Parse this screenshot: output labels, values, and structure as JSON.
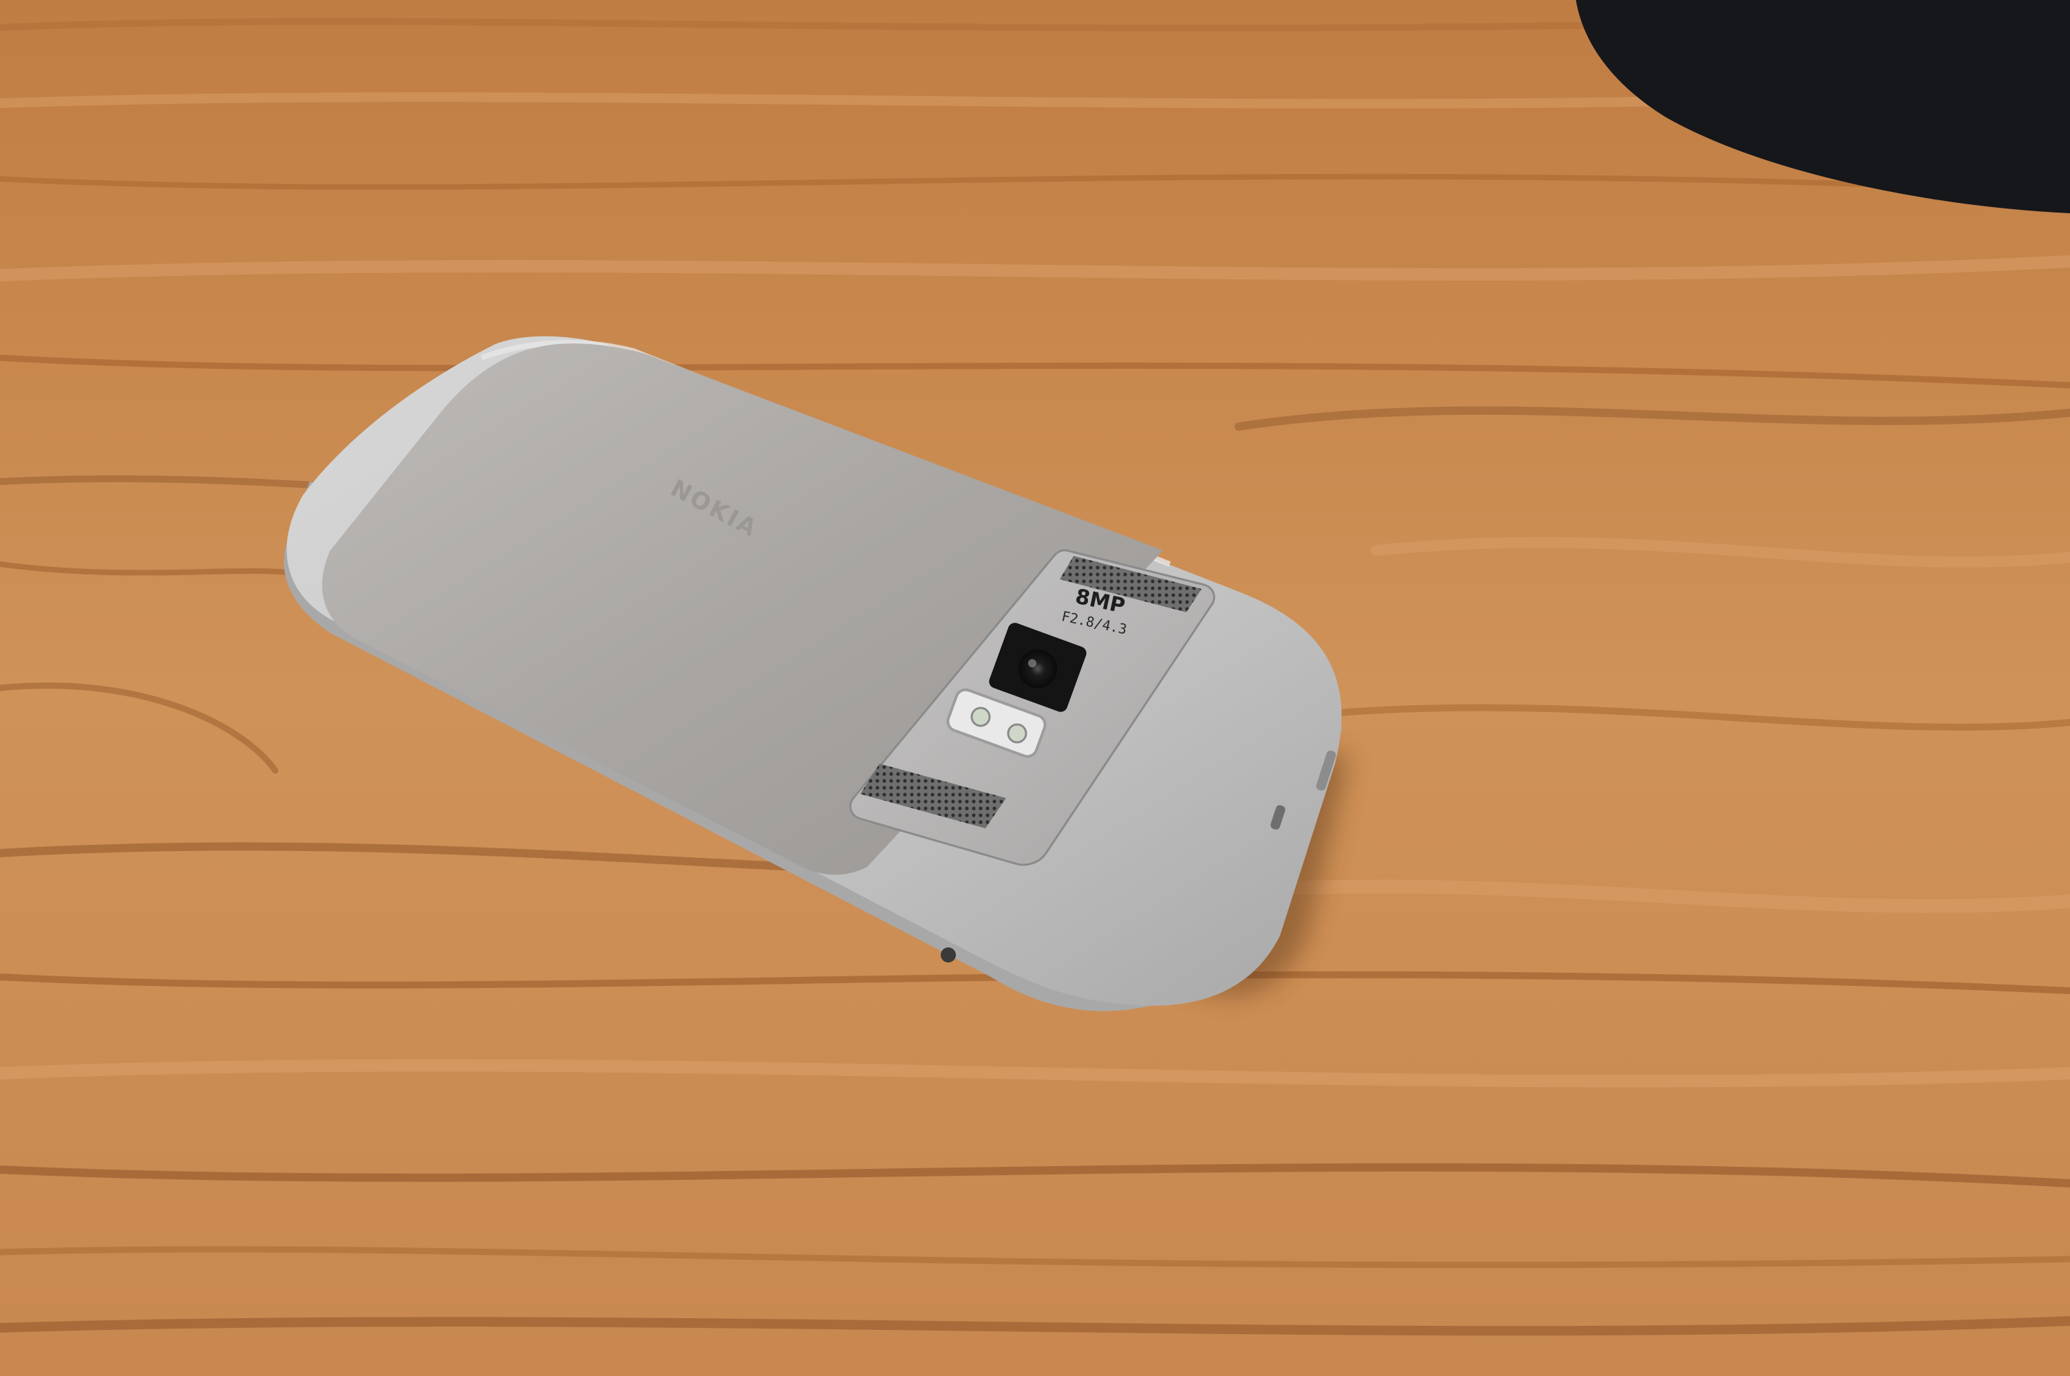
{
  "scene": {
    "subject": "phone-back",
    "surface": "wooden-table"
  },
  "phone": {
    "brand": "NOKIA",
    "camera_megapixels": "8MP",
    "camera_lens_spec": "F2.8/4.3"
  },
  "colors": {
    "wood_base": "#c98a4f",
    "wood_light": "#dca06a",
    "wood_dark": "#8f5428",
    "phone_frame": "#c9c9c9",
    "phone_cover": "#a9a6a3",
    "lens_black": "#111111",
    "background_object": "#15171a"
  }
}
